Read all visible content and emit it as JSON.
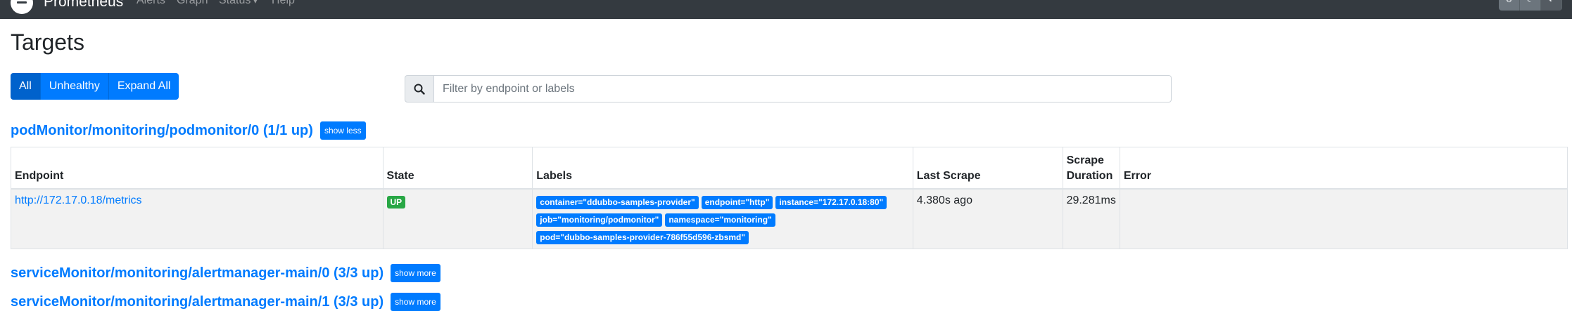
{
  "navbar": {
    "brand": "Prometheus",
    "links": [
      "Alerts",
      "Graph",
      "Status",
      "Help"
    ],
    "status_caret": "▾",
    "theme_icons": [
      "gear-icon",
      "moon-icon",
      "contrast-icon"
    ],
    "theme_glyphs": [
      "⚙",
      "☾",
      "◐"
    ]
  },
  "page": {
    "title": "Targets"
  },
  "filters": {
    "all": "All",
    "unhealthy": "Unhealthy",
    "expand_all": "Expand All"
  },
  "search": {
    "placeholder": "Filter by endpoint or labels",
    "icon": "search-icon"
  },
  "pools": [
    {
      "title": "podMonitor/monitoring/podmonitor/0 (1/1 up)",
      "toggle": "show less",
      "table": {
        "headers": [
          "Endpoint",
          "State",
          "Labels",
          "Last Scrape",
          "Scrape Duration",
          "Error"
        ],
        "rows": [
          {
            "endpoint": "http://172.17.0.18/metrics",
            "state": "UP",
            "labels": [
              "container=\"ddubbo-samples-provider\"",
              "endpoint=\"http\"",
              "instance=\"172.17.0.18:80\"",
              "job=\"monitoring/podmonitor\"",
              "namespace=\"monitoring\"",
              "pod=\"dubbo-samples-provider-786f55d596-zbsmd\""
            ],
            "last_scrape": "4.380s ago",
            "scrape_duration": "29.281ms",
            "error": ""
          }
        ]
      }
    },
    {
      "title": "serviceMonitor/monitoring/alertmanager-main/0 (3/3 up)",
      "toggle": "show more"
    },
    {
      "title": "serviceMonitor/monitoring/alertmanager-main/1 (3/3 up)",
      "toggle": "show more"
    }
  ],
  "colors": {
    "navbar": "#343a40",
    "primary": "#007bff",
    "success": "#28a745",
    "row_bg": "#f2f2f2"
  }
}
